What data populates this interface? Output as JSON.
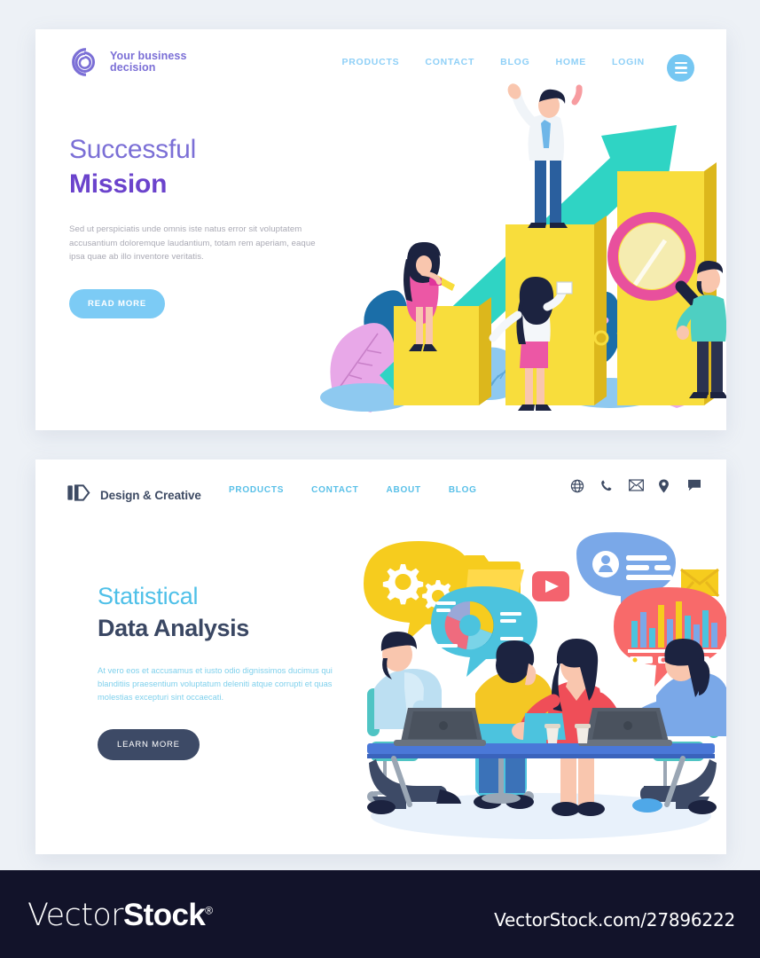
{
  "page": {
    "background_color": "#edf1f6"
  },
  "panel_one": {
    "brand": {
      "logo_icon": "spiral-swirl-logo-icon",
      "line1": "Your business",
      "line2": "decision",
      "color": "#7b6fd6"
    },
    "nav": [
      {
        "label": "PRODUCTS"
      },
      {
        "label": "CONTACT"
      },
      {
        "label": "BLOG"
      },
      {
        "label": "HOME"
      },
      {
        "label": "LOGIN"
      }
    ],
    "nav_color": "#8fd0f7",
    "menu_button": {
      "icon": "hamburger-menu-icon",
      "color": "#76c7f2"
    },
    "heading_light": "Successful",
    "heading_bold": "Mission",
    "heading_light_color": "#7b6fd6",
    "heading_bold_color": "#6b43cc",
    "body": "Sed ut perspiciatis unde omnis iste natus error sit voluptatem accusantium doloremque laudantium, totam rem aperiam, eaque ipsa quae ab illo inventore veritatis.",
    "cta_label": "READ MORE",
    "cta_color": "#7ccbf5",
    "illustration": {
      "name": "business-growth-bar-chart-illustration",
      "description": "Three yellow bar-chart columns of increasing height with a large teal upward arrow; a woman in pink dress with clipboard stands on the first bar, a man in white shirt and blue tie cheers on the middle bar, a woman writes on the middle bar, a bearded man in teal sweater holds a pink magnifying glass beside the tallest bar; blue and pink leaf foliage decorates the base.",
      "colors": {
        "bar_face": "#f8dd3c",
        "bar_side": "#e0b81f",
        "arrow": "#2fd4c4",
        "leaf_pink": "#e8a8e8",
        "leaf_blue": "#8ec9f0",
        "leaf_navy": "#1b6ea8",
        "dress_pink": "#ec57a5",
        "magnifier": "#e8509d",
        "sweater_teal": "#4ecfc2"
      }
    }
  },
  "panel_two": {
    "brand": {
      "logo_icon": "hexagon-bar-logo-icon",
      "label": "Design & Creative",
      "color": "#3d4a63"
    },
    "nav": [
      {
        "label": "PRODUCTS"
      },
      {
        "label": "CONTACT"
      },
      {
        "label": "ABOUT"
      },
      {
        "label": "BLOG"
      }
    ],
    "nav_color": "#59c0e8",
    "icons": [
      {
        "name": "globe-icon"
      },
      {
        "name": "phone-icon"
      },
      {
        "name": "envelope-icon"
      },
      {
        "name": "location-pin-icon"
      },
      {
        "name": "chat-bubble-icon"
      }
    ],
    "icon_color": "#3d4a63",
    "heading_light": "Statistical",
    "heading_bold": "Data Analysis",
    "heading_light_color": "#4fc0e8",
    "heading_bold_color": "#3a4763",
    "body": "At vero eos et accusamus et iusto odio dignissimos ducimus qui blanditiis praesentium voluptatum deleniti atque corrupti et quas molestias excepturi sint occaecati.",
    "cta_label": "LEARN MORE",
    "cta_color": "#3d4a66",
    "illustration": {
      "name": "team-meeting-data-analysis-illustration",
      "description": "Four colleagues around a blue conference table with laptops; a woman in red dress stands presenting. Above them float speech bubbles: yellow bubble with white gears, teal bubble with a donut/pie chart, blue bubble with a user profile and text lines, coral bubble with a bar chart, plus a yellow folder, a red video-play button and a yellow envelope.",
      "colors": {
        "table": "#4a78d8",
        "bubble_yellow": "#f6cc1e",
        "bubble_teal": "#4cc3de",
        "bubble_blue": "#7aa8e8",
        "bubble_coral": "#f86a6a",
        "dress_red": "#ef4e58",
        "chair_teal": "#4fc4c4",
        "laptop_gray": "#555e6b",
        "shirt_yellow": "#f4c724",
        "shirt_lightblue": "#bcdff2",
        "shirt_blue": "#7aa8e8",
        "floor_shadow": "#e8f1fb"
      },
      "bubble_chart_bars": [
        50,
        78,
        62,
        90,
        42,
        100,
        70,
        55,
        85,
        48
      ]
    }
  },
  "footer": {
    "logo_thin": "Vector",
    "logo_thick": "Stock",
    "registered_mark": "®",
    "url": "VectorStock.com/27896222",
    "background_color": "#12132a"
  }
}
